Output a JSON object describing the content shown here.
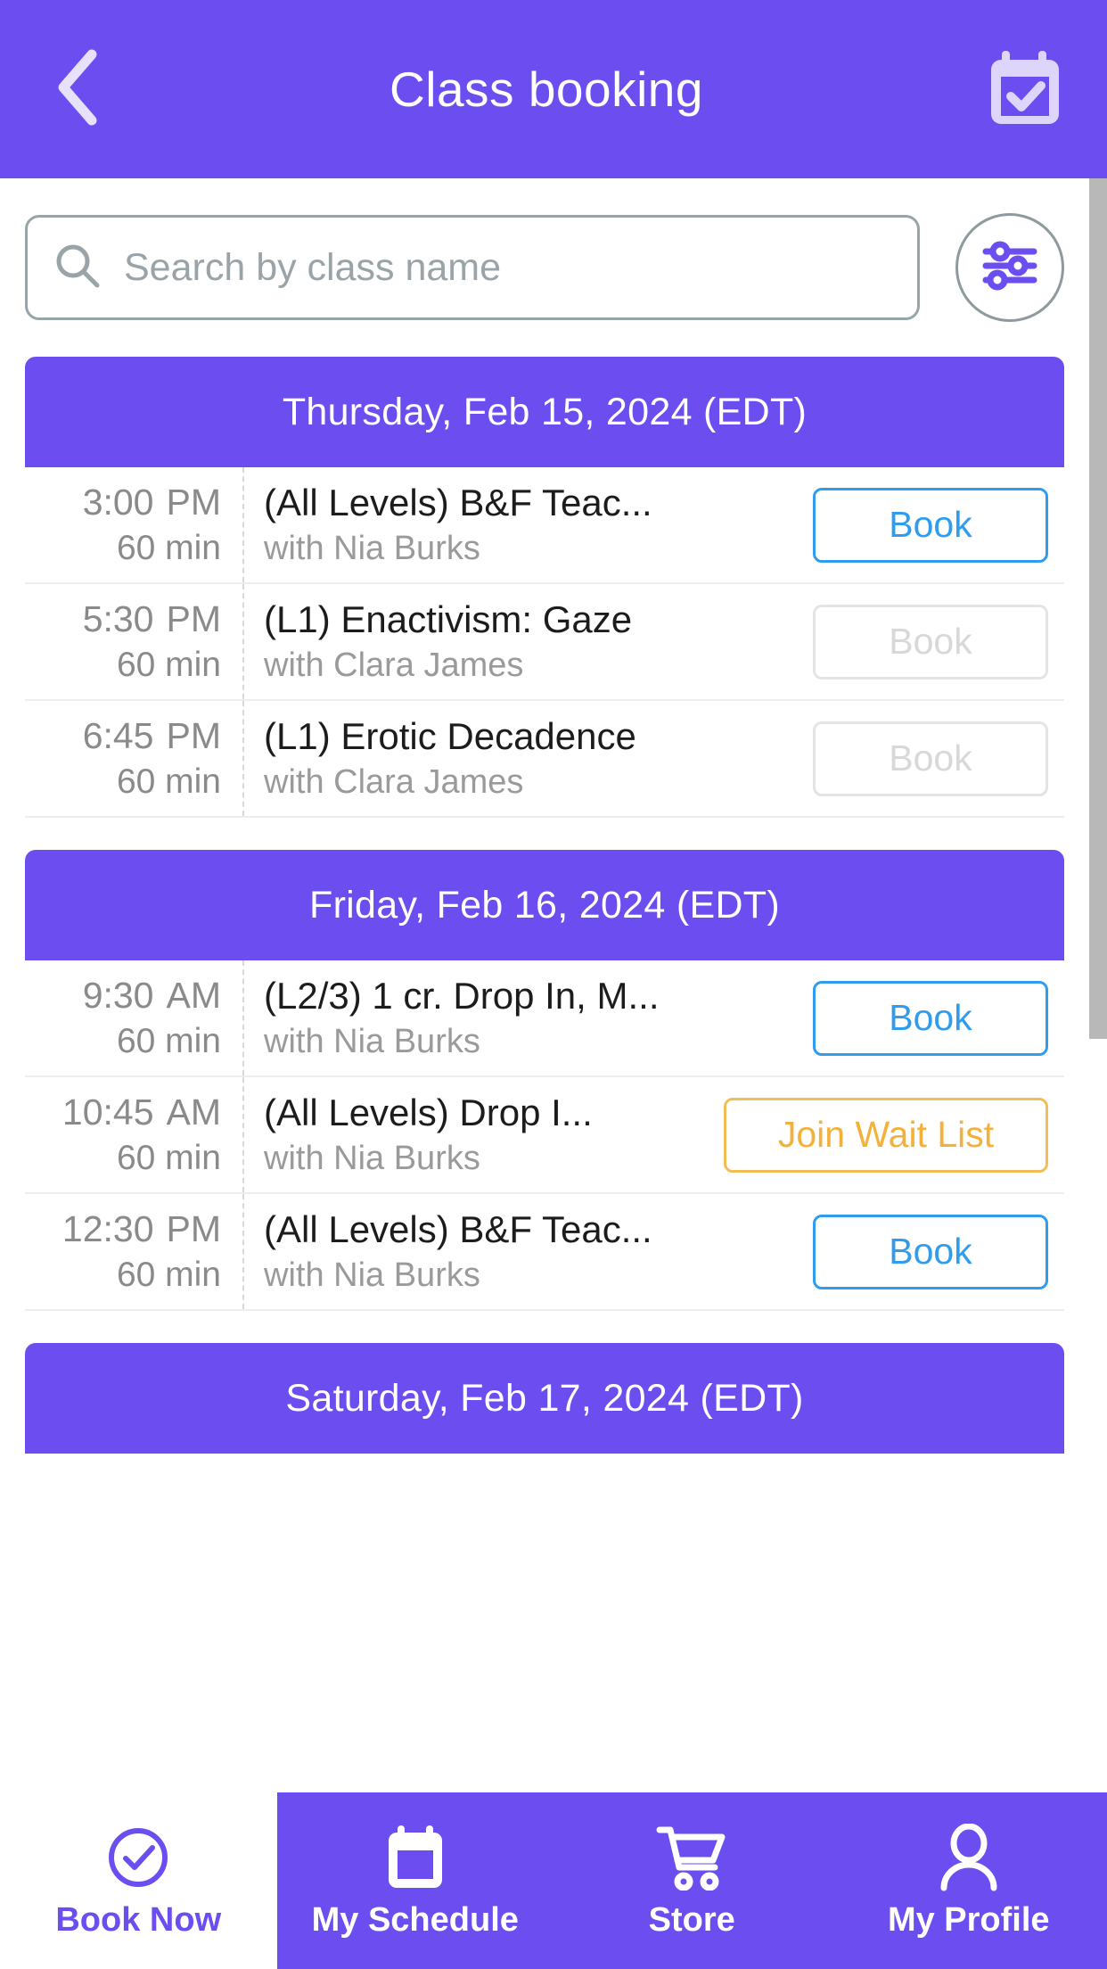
{
  "header": {
    "title": "Class booking",
    "back_icon": "chevron-left-icon",
    "action_icon": "calendar-check-icon"
  },
  "search": {
    "placeholder": "Search by class name",
    "value": "",
    "search_icon": "search-icon",
    "filter_icon": "sliders-filter-icon"
  },
  "colors": {
    "brand_purple": "#6c4df0",
    "book_blue": "#2f9ced",
    "waitlist_amber": "#f3b13b",
    "disabled_gray": "#d8d8d8"
  },
  "schedule": [
    {
      "date_label": "Thursday, Feb 15, 2024 (EDT)",
      "classes": [
        {
          "time": "3:00",
          "ampm": "PM",
          "duration": "60 min",
          "name": "(All Levels) B&F Teac...",
          "teacher": "with Nia Burks",
          "action_label": "Book",
          "action_state": "book"
        },
        {
          "time": "5:30",
          "ampm": "PM",
          "duration": "60 min",
          "name": "(L1) Enactivism: Gaze",
          "teacher": "with Clara James",
          "action_label": "Book",
          "action_state": "disabled"
        },
        {
          "time": "6:45",
          "ampm": "PM",
          "duration": "60 min",
          "name": "(L1) Erotic Decadence",
          "teacher": "with Clara James",
          "action_label": "Book",
          "action_state": "disabled"
        }
      ]
    },
    {
      "date_label": "Friday, Feb 16, 2024 (EDT)",
      "classes": [
        {
          "time": "9:30",
          "ampm": "AM",
          "duration": "60 min",
          "name": "(L2/3) 1 cr. Drop In, M...",
          "teacher": "with Nia Burks",
          "action_label": "Book",
          "action_state": "book"
        },
        {
          "time": "10:45",
          "ampm": "AM",
          "duration": "60 min",
          "name": "(All Levels) Drop I...",
          "teacher": "with Nia Burks",
          "action_label": "Join Wait List",
          "action_state": "waitlist"
        },
        {
          "time": "12:30",
          "ampm": "PM",
          "duration": "60 min",
          "name": "(All Levels) B&F Teac...",
          "teacher": "with Nia Burks",
          "action_label": "Book",
          "action_state": "book"
        }
      ]
    },
    {
      "date_label": "Saturday, Feb 17, 2024 (EDT)",
      "classes": []
    }
  ],
  "bottom_nav": [
    {
      "label": "Book Now",
      "icon": "check-circle-icon",
      "active": true
    },
    {
      "label": "My Schedule",
      "icon": "calendar-icon",
      "active": false
    },
    {
      "label": "Store",
      "icon": "shopping-cart-icon",
      "active": false
    },
    {
      "label": "My Profile",
      "icon": "user-icon",
      "active": false
    }
  ]
}
